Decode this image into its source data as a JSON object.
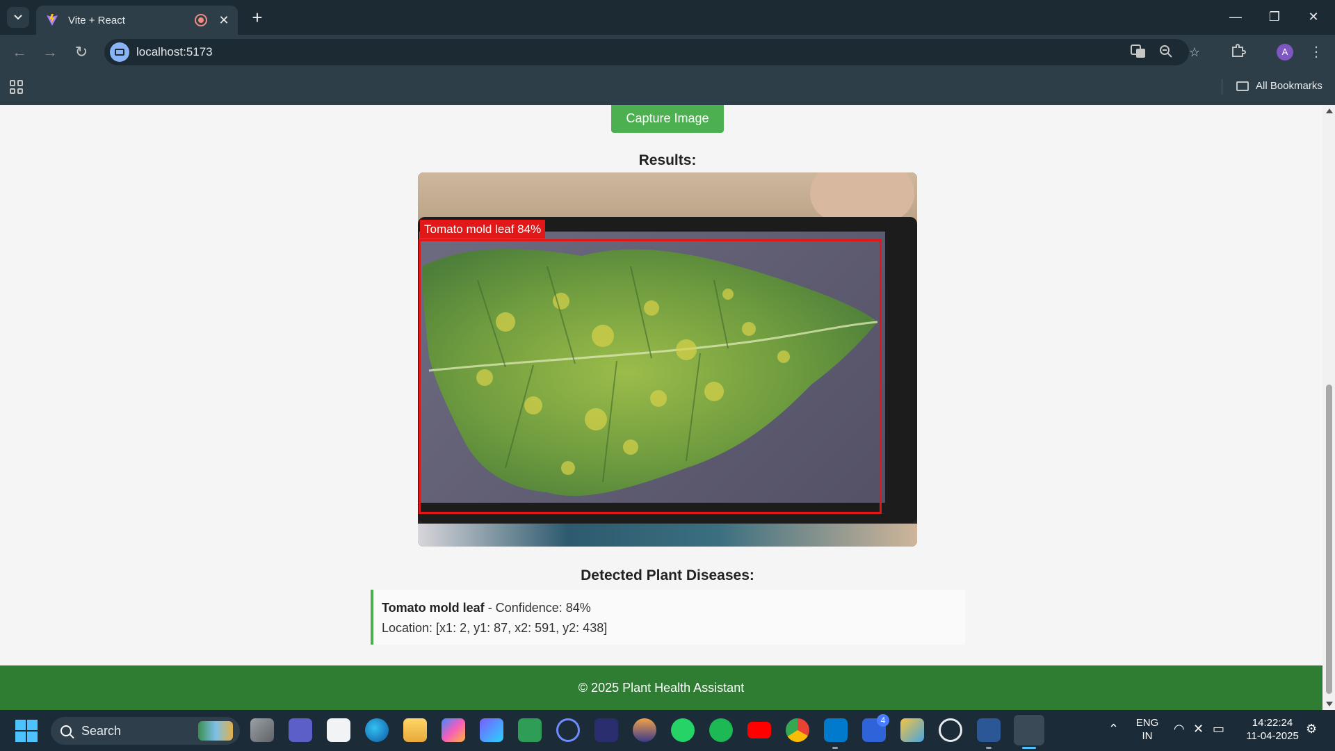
{
  "browser": {
    "tab_title": "Vite + React",
    "url": "localhost:5173",
    "bookmarks_label": "All Bookmarks",
    "profile_initial": "A"
  },
  "page": {
    "capture_button": "Capture Image",
    "results_heading": "Results:",
    "bbox_label": "Tomato mold leaf 84%",
    "detected_heading": "Detected Plant Diseases:",
    "detection": {
      "name": "Tomato mold leaf",
      "confidence_text": " - Confidence: 84%",
      "location_text": "Location: [x1: 2, y1: 87, x2: 591, y2: 438]"
    },
    "footer": "© 2025 Plant Health Assistant"
  },
  "taskbar": {
    "search_placeholder": "Search",
    "notification_count": "4",
    "language": "ENG",
    "region": "IN",
    "time": "14:22:24",
    "date": "11-04-2025"
  },
  "colors": {
    "accent_green": "#4caf50",
    "footer_green": "#2e7d32",
    "bbox_red": "#e21818"
  }
}
